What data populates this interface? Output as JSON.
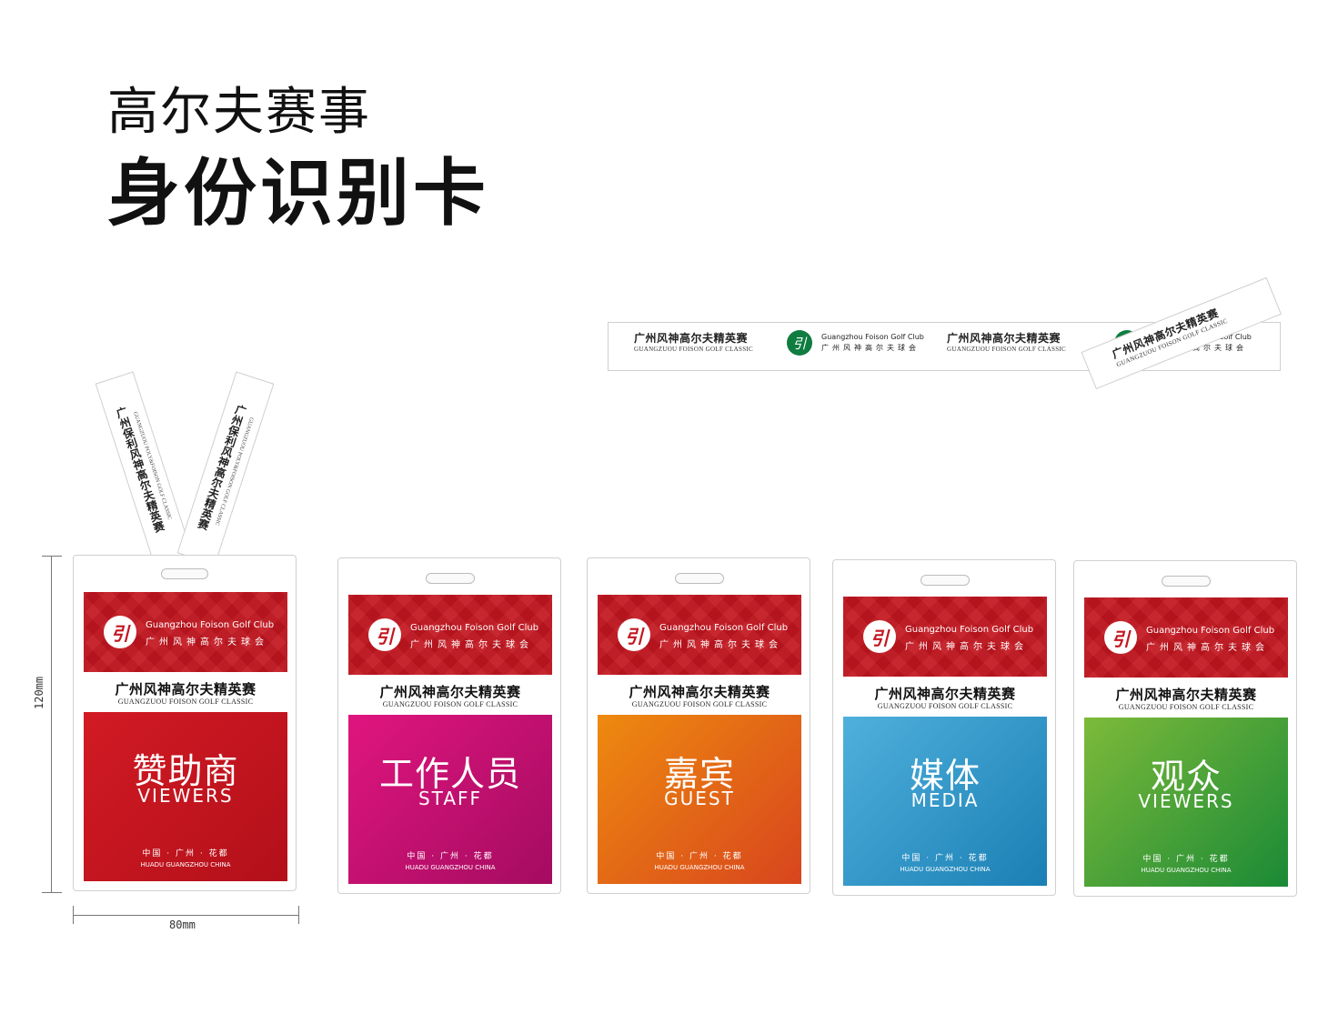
{
  "heading": {
    "line1": "高尔夫赛事",
    "line2": "身份识别卡"
  },
  "event": {
    "name_cn": "广州风神高尔夫精英赛",
    "name_en": "GUANGZUOU FOISON GOLF CLASSIC"
  },
  "club": {
    "name_en": "Guangzhou Foison Golf Club",
    "name_cn": "广州风神高尔夫球会",
    "logo_glyph": "引",
    "logo_color": "#0f7d40",
    "header_color": "#c3161f"
  },
  "lanyard": {
    "strap_text_1": "广州保利风神高尔夫精英赛",
    "strap_text_2": "广州保利风神高尔夫精英赛",
    "strap_en": "GUANGZUOU POLY&FOISON GOLF CLASSIC"
  },
  "location": {
    "cn": "中国 · 广州 · 花都",
    "en": "HUADU GUANGZHOU CHINA"
  },
  "cards": [
    {
      "role_cn": "赞助商",
      "role_en": "VIEWERS",
      "color_start": "#d21a24",
      "color_end": "#b3101a"
    },
    {
      "role_cn": "工作人员",
      "role_en": "STAFF",
      "color_start": "#e0157f",
      "color_end": "#a40c60"
    },
    {
      "role_cn": "嘉宾",
      "role_en": "GUEST",
      "color_start": "#ee8a0f",
      "color_end": "#d8451e"
    },
    {
      "role_cn": "媒体",
      "role_en": "MEDIA",
      "color_start": "#4fb0dc",
      "color_end": "#1a7fb4"
    },
    {
      "role_cn": "观众",
      "role_en": "VIEWERS",
      "color_start": "#7dba3a",
      "color_end": "#1a8a36"
    }
  ],
  "dimensions": {
    "height_label": "120mm",
    "width_label": "80mm"
  }
}
